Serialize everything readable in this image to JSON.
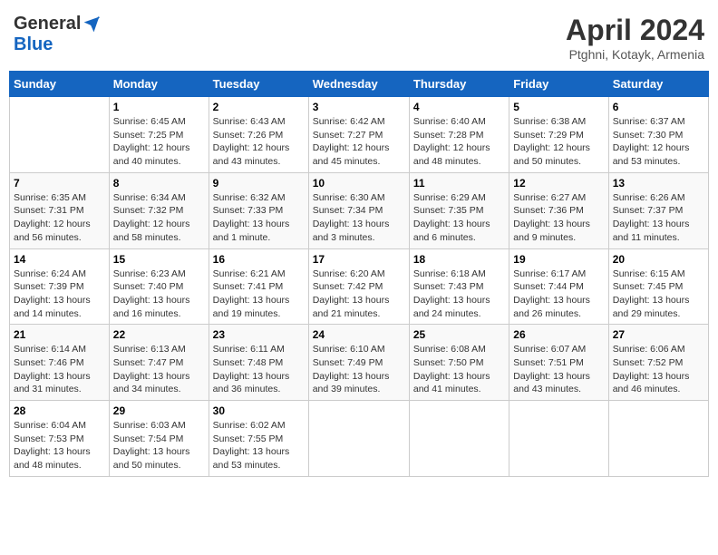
{
  "header": {
    "logo_general": "General",
    "logo_blue": "Blue",
    "month_title": "April 2024",
    "location": "Ptghni, Kotayk, Armenia"
  },
  "days_of_week": [
    "Sunday",
    "Monday",
    "Tuesday",
    "Wednesday",
    "Thursday",
    "Friday",
    "Saturday"
  ],
  "weeks": [
    [
      {
        "day": "",
        "sunrise": "",
        "sunset": "",
        "daylight": ""
      },
      {
        "day": "1",
        "sunrise": "Sunrise: 6:45 AM",
        "sunset": "Sunset: 7:25 PM",
        "daylight": "Daylight: 12 hours and 40 minutes."
      },
      {
        "day": "2",
        "sunrise": "Sunrise: 6:43 AM",
        "sunset": "Sunset: 7:26 PM",
        "daylight": "Daylight: 12 hours and 43 minutes."
      },
      {
        "day": "3",
        "sunrise": "Sunrise: 6:42 AM",
        "sunset": "Sunset: 7:27 PM",
        "daylight": "Daylight: 12 hours and 45 minutes."
      },
      {
        "day": "4",
        "sunrise": "Sunrise: 6:40 AM",
        "sunset": "Sunset: 7:28 PM",
        "daylight": "Daylight: 12 hours and 48 minutes."
      },
      {
        "day": "5",
        "sunrise": "Sunrise: 6:38 AM",
        "sunset": "Sunset: 7:29 PM",
        "daylight": "Daylight: 12 hours and 50 minutes."
      },
      {
        "day": "6",
        "sunrise": "Sunrise: 6:37 AM",
        "sunset": "Sunset: 7:30 PM",
        "daylight": "Daylight: 12 hours and 53 minutes."
      }
    ],
    [
      {
        "day": "7",
        "sunrise": "Sunrise: 6:35 AM",
        "sunset": "Sunset: 7:31 PM",
        "daylight": "Daylight: 12 hours and 56 minutes."
      },
      {
        "day": "8",
        "sunrise": "Sunrise: 6:34 AM",
        "sunset": "Sunset: 7:32 PM",
        "daylight": "Daylight: 12 hours and 58 minutes."
      },
      {
        "day": "9",
        "sunrise": "Sunrise: 6:32 AM",
        "sunset": "Sunset: 7:33 PM",
        "daylight": "Daylight: 13 hours and 1 minute."
      },
      {
        "day": "10",
        "sunrise": "Sunrise: 6:30 AM",
        "sunset": "Sunset: 7:34 PM",
        "daylight": "Daylight: 13 hours and 3 minutes."
      },
      {
        "day": "11",
        "sunrise": "Sunrise: 6:29 AM",
        "sunset": "Sunset: 7:35 PM",
        "daylight": "Daylight: 13 hours and 6 minutes."
      },
      {
        "day": "12",
        "sunrise": "Sunrise: 6:27 AM",
        "sunset": "Sunset: 7:36 PM",
        "daylight": "Daylight: 13 hours and 9 minutes."
      },
      {
        "day": "13",
        "sunrise": "Sunrise: 6:26 AM",
        "sunset": "Sunset: 7:37 PM",
        "daylight": "Daylight: 13 hours and 11 minutes."
      }
    ],
    [
      {
        "day": "14",
        "sunrise": "Sunrise: 6:24 AM",
        "sunset": "Sunset: 7:39 PM",
        "daylight": "Daylight: 13 hours and 14 minutes."
      },
      {
        "day": "15",
        "sunrise": "Sunrise: 6:23 AM",
        "sunset": "Sunset: 7:40 PM",
        "daylight": "Daylight: 13 hours and 16 minutes."
      },
      {
        "day": "16",
        "sunrise": "Sunrise: 6:21 AM",
        "sunset": "Sunset: 7:41 PM",
        "daylight": "Daylight: 13 hours and 19 minutes."
      },
      {
        "day": "17",
        "sunrise": "Sunrise: 6:20 AM",
        "sunset": "Sunset: 7:42 PM",
        "daylight": "Daylight: 13 hours and 21 minutes."
      },
      {
        "day": "18",
        "sunrise": "Sunrise: 6:18 AM",
        "sunset": "Sunset: 7:43 PM",
        "daylight": "Daylight: 13 hours and 24 minutes."
      },
      {
        "day": "19",
        "sunrise": "Sunrise: 6:17 AM",
        "sunset": "Sunset: 7:44 PM",
        "daylight": "Daylight: 13 hours and 26 minutes."
      },
      {
        "day": "20",
        "sunrise": "Sunrise: 6:15 AM",
        "sunset": "Sunset: 7:45 PM",
        "daylight": "Daylight: 13 hours and 29 minutes."
      }
    ],
    [
      {
        "day": "21",
        "sunrise": "Sunrise: 6:14 AM",
        "sunset": "Sunset: 7:46 PM",
        "daylight": "Daylight: 13 hours and 31 minutes."
      },
      {
        "day": "22",
        "sunrise": "Sunrise: 6:13 AM",
        "sunset": "Sunset: 7:47 PM",
        "daylight": "Daylight: 13 hours and 34 minutes."
      },
      {
        "day": "23",
        "sunrise": "Sunrise: 6:11 AM",
        "sunset": "Sunset: 7:48 PM",
        "daylight": "Daylight: 13 hours and 36 minutes."
      },
      {
        "day": "24",
        "sunrise": "Sunrise: 6:10 AM",
        "sunset": "Sunset: 7:49 PM",
        "daylight": "Daylight: 13 hours and 39 minutes."
      },
      {
        "day": "25",
        "sunrise": "Sunrise: 6:08 AM",
        "sunset": "Sunset: 7:50 PM",
        "daylight": "Daylight: 13 hours and 41 minutes."
      },
      {
        "day": "26",
        "sunrise": "Sunrise: 6:07 AM",
        "sunset": "Sunset: 7:51 PM",
        "daylight": "Daylight: 13 hours and 43 minutes."
      },
      {
        "day": "27",
        "sunrise": "Sunrise: 6:06 AM",
        "sunset": "Sunset: 7:52 PM",
        "daylight": "Daylight: 13 hours and 46 minutes."
      }
    ],
    [
      {
        "day": "28",
        "sunrise": "Sunrise: 6:04 AM",
        "sunset": "Sunset: 7:53 PM",
        "daylight": "Daylight: 13 hours and 48 minutes."
      },
      {
        "day": "29",
        "sunrise": "Sunrise: 6:03 AM",
        "sunset": "Sunset: 7:54 PM",
        "daylight": "Daylight: 13 hours and 50 minutes."
      },
      {
        "day": "30",
        "sunrise": "Sunrise: 6:02 AM",
        "sunset": "Sunset: 7:55 PM",
        "daylight": "Daylight: 13 hours and 53 minutes."
      },
      {
        "day": "",
        "sunrise": "",
        "sunset": "",
        "daylight": ""
      },
      {
        "day": "",
        "sunrise": "",
        "sunset": "",
        "daylight": ""
      },
      {
        "day": "",
        "sunrise": "",
        "sunset": "",
        "daylight": ""
      },
      {
        "day": "",
        "sunrise": "",
        "sunset": "",
        "daylight": ""
      }
    ]
  ]
}
